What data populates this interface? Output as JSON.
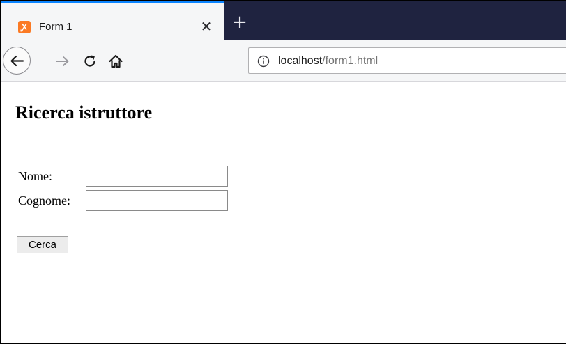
{
  "browser": {
    "tab": {
      "title": "Form 1",
      "favicon": "xampp-icon",
      "close_symbol": "✕"
    },
    "new_tab_symbol": "+",
    "nav": {
      "back_icon": "back-arrow-icon",
      "forward_icon": "forward-arrow-icon",
      "reload_icon": "reload-icon",
      "home_icon": "home-icon"
    },
    "urlbar": {
      "info_icon": "info-icon",
      "host": "localhost",
      "path": "/form1.html"
    }
  },
  "page": {
    "title": "Ricerca istruttore",
    "form": {
      "nome_label": "Nome:",
      "nome_value": "",
      "cognome_label": "Cognome:",
      "cognome_value": "",
      "submit_label": "Cerca"
    }
  },
  "colors": {
    "tabstrip_bg": "#1f2340",
    "tab_accent": "#0a84ff",
    "favicon": "#fb7a24",
    "toolbar_bg": "#f5f6f7"
  }
}
